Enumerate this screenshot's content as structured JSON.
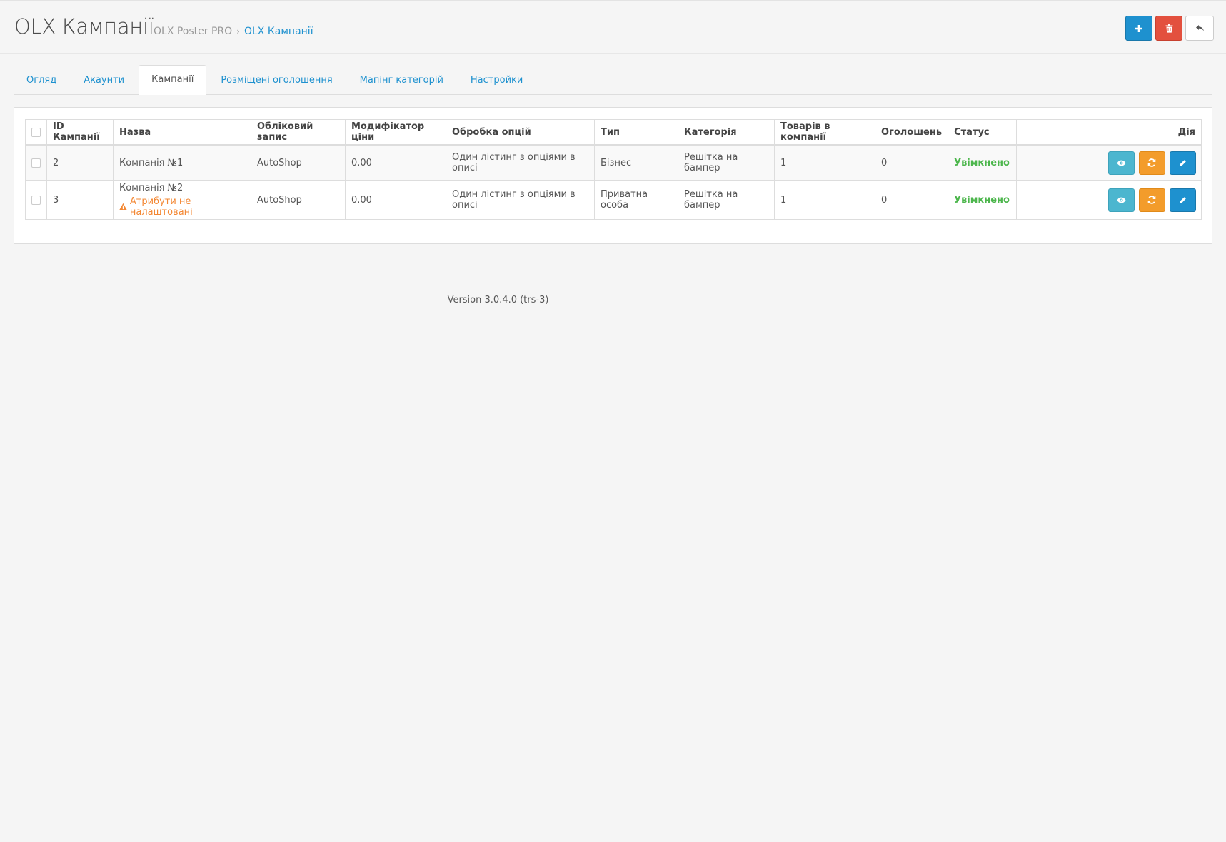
{
  "header": {
    "title": "OLX Кампанії",
    "breadcrumbs": [
      "OLX Poster PRO",
      "OLX Кампанії"
    ],
    "breadcrumb_separator": "›"
  },
  "actions": {
    "add_icon": "plus-icon",
    "delete_icon": "trash-icon",
    "back_icon": "reply-icon",
    "colors": {
      "primary": "#1e91cf",
      "danger": "#e3503e",
      "info": "#4cb6cf",
      "warning": "#f39c2b",
      "success": "#4cb64c"
    }
  },
  "tabs": [
    {
      "label": "Огляд",
      "active": false
    },
    {
      "label": "Акаунти",
      "active": false
    },
    {
      "label": "Кампанії",
      "active": true
    },
    {
      "label": "Розміщені оголошення",
      "active": false
    },
    {
      "label": "Мапінг категорій",
      "active": false
    },
    {
      "label": "Настройки",
      "active": false
    }
  ],
  "table": {
    "headers": {
      "id": "ID Кампанії",
      "name": "Назва",
      "account": "Обліковий запис",
      "price_mod": "Модифікатор ціни",
      "options": "Обробка опцій",
      "type": "Тип",
      "category": "Категорія",
      "products": "Товарів в компанії",
      "ads": "Оголошень",
      "status": "Статус",
      "action": "Дія"
    },
    "rows": [
      {
        "id": "2",
        "name": "Компанія №1",
        "warning": "",
        "account": "AutoShop",
        "price_mod": "0.00",
        "options": "Один лістинг з опціями в описі",
        "type": "Бізнес",
        "category": "Решітка на бампер",
        "products": "1",
        "ads": "0",
        "status": "Увімкнено"
      },
      {
        "id": "3",
        "name": "Компанія №2",
        "warning": "Атрибути не налаштовані",
        "account": "AutoShop",
        "price_mod": "0.00",
        "options": "Один лістинг з опціями в описі",
        "type": "Приватна особа",
        "category": "Решітка на бампер",
        "products": "1",
        "ads": "0",
        "status": "Увімкнено"
      }
    ]
  },
  "footer": {
    "version": "Version 3.0.4.0 (trs-3)"
  }
}
